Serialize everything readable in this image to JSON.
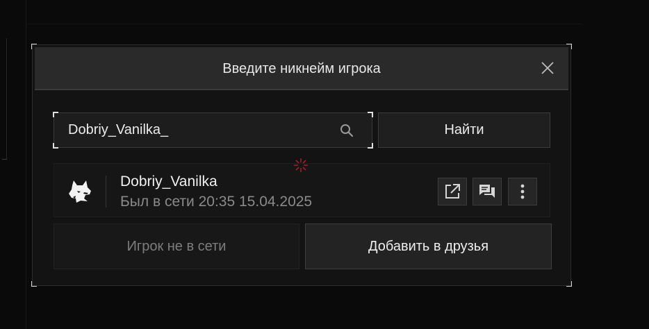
{
  "dialog": {
    "title": "Введите никнейм игрока"
  },
  "search": {
    "value": "Dobriy_Vanilka_",
    "find_label": "Найти"
  },
  "player": {
    "name": "Dobriy_Vanilka",
    "status": "Был в сети 20:35 15.04.2025"
  },
  "actions": {
    "offline_label": "Игрок не в сети",
    "add_friend_label": "Добавить в друзья"
  },
  "icons": {
    "close": "close-icon",
    "search": "search-icon",
    "avatar": "wolf-icon",
    "profile": "external-link-icon",
    "chat": "chat-icon",
    "more": "more-vertical-icon",
    "cursor": "crosshair-icon"
  },
  "colors": {
    "background": "#0a0a0a",
    "panel": "#131313",
    "header": "#2a2a2a",
    "cursor": "#c0202a"
  }
}
